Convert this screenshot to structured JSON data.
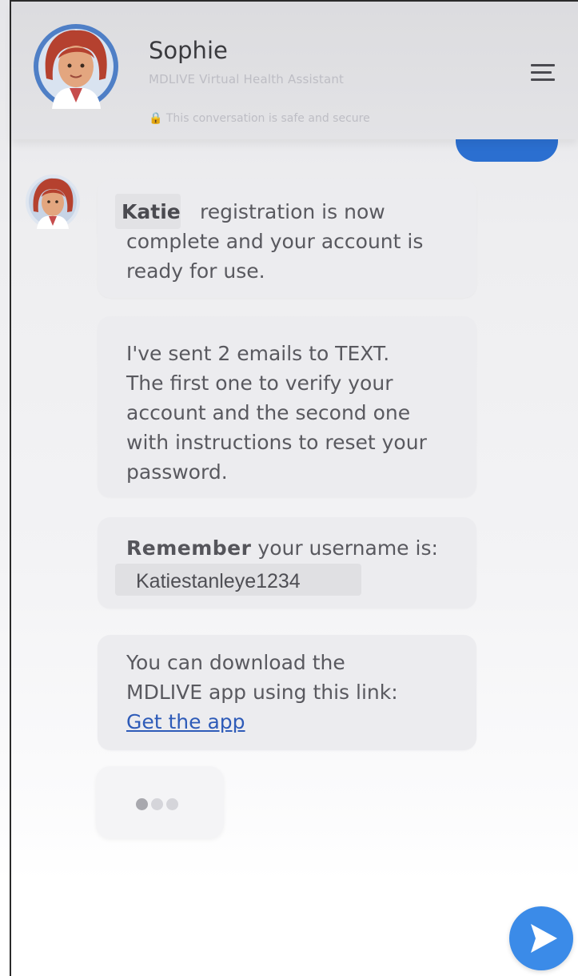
{
  "header": {
    "name": "Sophie",
    "subtitle": "MDLIVE Virtual Health Assistant",
    "secure_note": "🔒 This conversation is safe and secure"
  },
  "messages": {
    "m1": {
      "name": "Katie",
      "line1": "registration is now",
      "line2": "complete and your account is",
      "line3": "ready for use."
    },
    "m2": {
      "lines": [
        "I've sent 2 emails to TEXT.",
        "The first one to verify your",
        "account and the second one",
        "with instructions to reset your",
        "password."
      ]
    },
    "m3": {
      "bold": "Remember",
      "rest": " your username is:",
      "username": "Katiestanleye1234"
    },
    "m4": {
      "lines": [
        "You can download the",
        "MDLIVE app using this link:"
      ],
      "link": "Get the app"
    }
  },
  "colors": {
    "accent": "#3b8be8",
    "bubble": "#ececef",
    "link": "#2e5bb8"
  },
  "icons": {
    "menu": "hamburger-menu-icon",
    "send": "send-arrow-icon",
    "typing": "typing-dots-icon"
  }
}
